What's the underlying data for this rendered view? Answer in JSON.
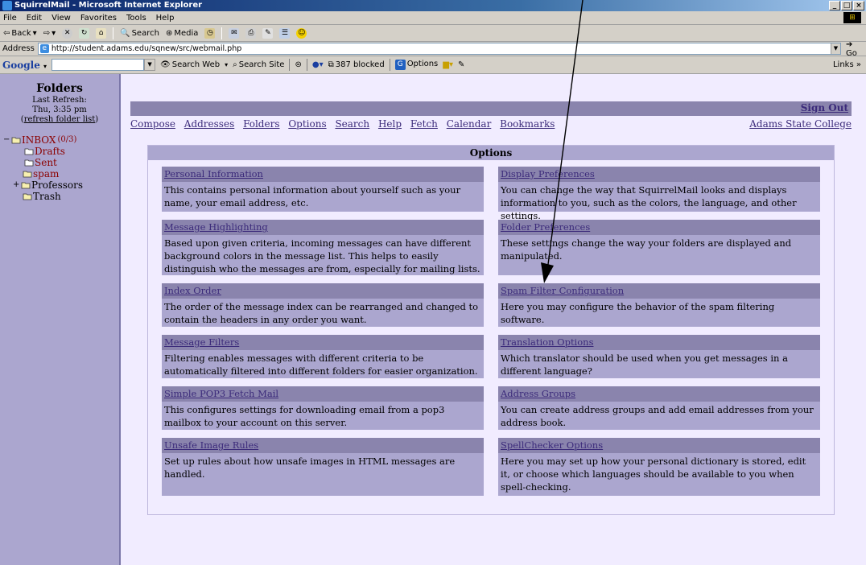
{
  "window": {
    "title": "SquirrelMail - Microsoft Internet Explorer",
    "controls": [
      "_",
      "□",
      "×"
    ]
  },
  "menubar": [
    "File",
    "Edit",
    "View",
    "Favorites",
    "Tools",
    "Help"
  ],
  "toolbar": {
    "back": "Back",
    "search": "Search",
    "media": "Media"
  },
  "addressbar": {
    "label": "Address",
    "url": "http://student.adams.edu/sqnew/src/webmail.php",
    "go": "Go"
  },
  "googlebar": {
    "logo": "Google",
    "search_web": "Search Web",
    "search_site": "Search Site",
    "blocked": "387 blocked",
    "options": "Options",
    "links": "Links"
  },
  "sidebar": {
    "title": "Folders",
    "last_refresh_label": "Last Refresh:",
    "last_refresh_time": "Thu, 3:35 pm",
    "refresh_link": "refresh folder list",
    "folders": [
      {
        "label": "INBOX",
        "count": "(0/3)"
      },
      {
        "label": "Drafts"
      },
      {
        "label": "Sent"
      },
      {
        "label": "spam"
      },
      {
        "label": "Professors"
      },
      {
        "label": "Trash"
      }
    ]
  },
  "header": {
    "sign_out": "Sign Out",
    "nav": [
      "Compose",
      "Addresses",
      "Folders",
      "Options",
      "Search",
      "Help",
      "Fetch",
      "Calendar",
      "Bookmarks"
    ],
    "org": "Adams State College"
  },
  "options": {
    "title": "Options",
    "items": [
      {
        "title": "Personal Information",
        "desc": "This contains personal information about yourself such as your name, your email address, etc."
      },
      {
        "title": "Display Preferences",
        "desc": "You can change the way that SquirrelMail looks and displays information to you, such as the colors, the language, and other settings."
      },
      {
        "title": "Message Highlighting",
        "desc": "Based upon given criteria, incoming messages can have different background colors in the message list. This helps to easily distinguish who the messages are from, especially for mailing lists."
      },
      {
        "title": "Folder Preferences",
        "desc": "These settings change the way your folders are displayed and manipulated."
      },
      {
        "title": "Index Order",
        "desc": "The order of the message index can be rearranged and changed to contain the headers in any order you want."
      },
      {
        "title": "Spam Filter Configuration",
        "desc": "Here you may configure the behavior of the spam filtering software."
      },
      {
        "title": "Message Filters",
        "desc": "Filtering enables messages with different criteria to be automatically filtered into different folders for easier organization."
      },
      {
        "title": "Translation Options",
        "desc": "Which translator should be used when you get messages in a different language?"
      },
      {
        "title": "Simple POP3 Fetch Mail",
        "desc": "This configures settings for downloading email from a pop3 mailbox to your account on this server."
      },
      {
        "title": "Address Groups",
        "desc": "You can create address groups and add email addresses from your address book."
      },
      {
        "title": "Unsafe Image Rules",
        "desc": "Set up rules about how unsafe images in HTML messages are handled."
      },
      {
        "title": "SpellChecker Options",
        "desc": "Here you may set up how your personal dictionary is stored, edit it, or choose which languages should be available to you when spell-checking."
      }
    ]
  },
  "colors": {
    "left_pane": "#aba6cf",
    "header_bar": "#8a84ad",
    "page_bg": "#f1ecff",
    "link": "#3b2a7a"
  }
}
